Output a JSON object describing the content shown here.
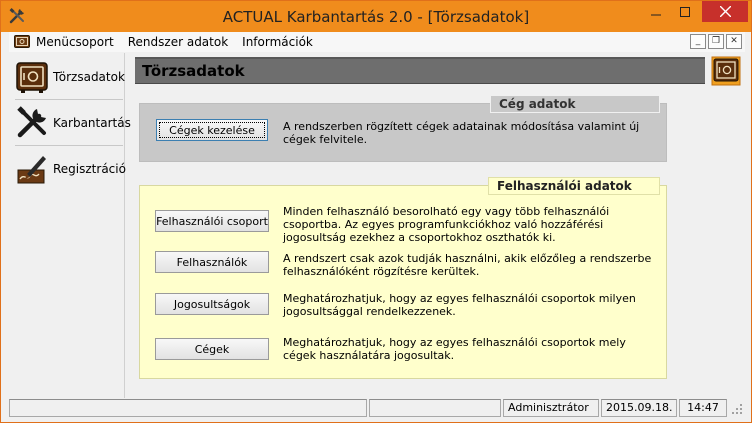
{
  "window": {
    "title": "ACTUAL Karbantartás 2.0 - [Törzsadatok]",
    "accent_color": "#f08c1c",
    "close_color": "#c7302b"
  },
  "menubar": {
    "items": [
      "Menücsoport",
      "Rendszer adatok",
      "Információk"
    ]
  },
  "nav": {
    "items": [
      {
        "label": "Törzsadatok",
        "icon": "safe-icon"
      },
      {
        "label": "Karbantartás",
        "icon": "tools-icon"
      },
      {
        "label": "Regisztráció",
        "icon": "signature-icon"
      }
    ]
  },
  "content": {
    "title": "Törzsadatok",
    "ceg_group": {
      "label": "Cég adatok",
      "button": "Cégek kezelése",
      "description": "A rendszerben rögzített cégek adatainak módosítása valamint új cégek felvitele."
    },
    "felh_group": {
      "label": "Felhasználói adatok",
      "rows": [
        {
          "button": "Felhasználói csoport",
          "description": "Minden felhasználó besorolható egy vagy több felhasználói csoportba. Az egyes programfunkciókhoz való hozzáférési jogosultság ezekhez a csoportokhoz oszthatók ki."
        },
        {
          "button": "Felhasználók",
          "description": "A rendszert csak azok tudják használni, akik előzőleg a rendszerbe felhasználóként rögzítésre kerültek."
        },
        {
          "button": "Jogosultságok",
          "description": "Meghatározhatjuk, hogy az egyes felhasználói csoportok milyen jogosultsággal rendelkezzenek."
        },
        {
          "button": "Cégek",
          "description": "Meghatározhatjuk, hogy az egyes felhasználói csoportok mely cégek használatára jogosultak."
        }
      ]
    }
  },
  "statusbar": {
    "user": "Adminisztrátor",
    "date": "2015.09.18.",
    "time": "14:47"
  }
}
